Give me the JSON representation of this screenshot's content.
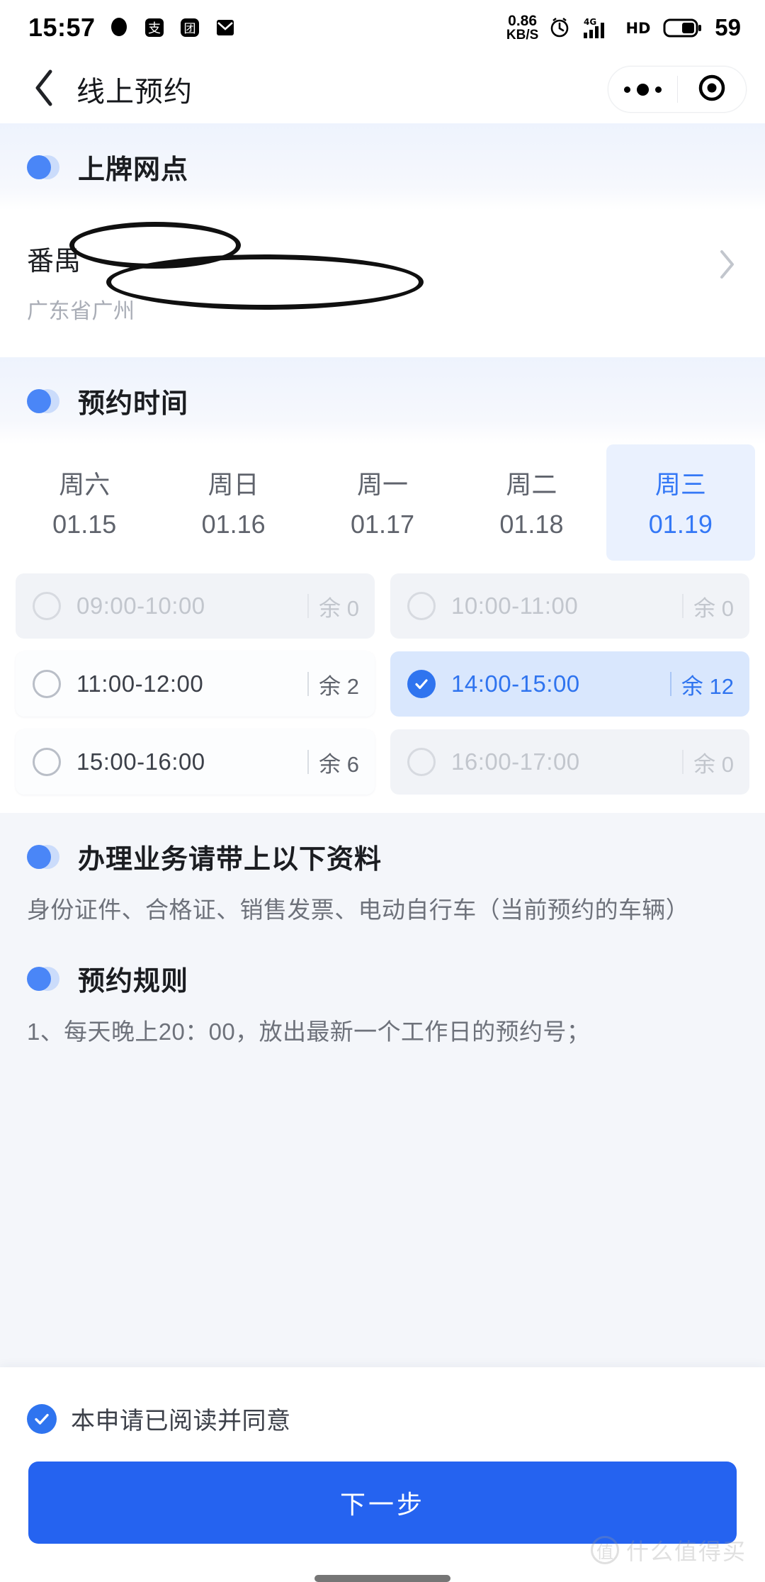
{
  "status_bar": {
    "time": "15:57",
    "net_speed_value": "0.86",
    "net_speed_unit": "KB/S",
    "network_type": "4G",
    "audio_badge": "HD",
    "battery_percent": "59",
    "left_icons": [
      "chat-bubble-icon",
      "alipay-icon",
      "meituan-icon",
      "mail-icon"
    ],
    "right_icons": [
      "alarm-clock-icon",
      "signal-bars-icon",
      "hd-audio-icon",
      "battery-icon"
    ]
  },
  "nav": {
    "back_icon": "chevron-left-icon",
    "title": "线上预约",
    "capsule": {
      "more_icon": "more-dots-icon",
      "close_icon": "target-circle-icon"
    }
  },
  "sections": {
    "store": {
      "heading": "上牌网点",
      "name": "番禺",
      "address": "广东省广州",
      "chevron_icon": "chevron-right-icon"
    },
    "time": {
      "heading": "预约时间"
    },
    "materials": {
      "heading": "办理业务请带上以下资料",
      "text": "身份证件、合格证、销售发票、电动自行车（当前预约的车辆）"
    },
    "rules": {
      "heading": "预约规则",
      "items": [
        "1、每天晚上20：00，放出最新一个工作日的预约号；"
      ]
    }
  },
  "dates": [
    {
      "weekday": "周六",
      "date": "01.15",
      "selected": false
    },
    {
      "weekday": "周日",
      "date": "01.16",
      "selected": false
    },
    {
      "weekday": "周一",
      "date": "01.17",
      "selected": false
    },
    {
      "weekday": "周二",
      "date": "01.18",
      "selected": false
    },
    {
      "weekday": "周三",
      "date": "01.19",
      "selected": true
    }
  ],
  "slots": [
    {
      "time": "09:00-10:00",
      "remaining": "余 0",
      "state": "disabled"
    },
    {
      "time": "10:00-11:00",
      "remaining": "余 0",
      "state": "disabled"
    },
    {
      "time": "11:00-12:00",
      "remaining": "余 2",
      "state": "available"
    },
    {
      "time": "14:00-15:00",
      "remaining": "余 12",
      "state": "selected"
    },
    {
      "time": "15:00-16:00",
      "remaining": "余 6",
      "state": "available"
    },
    {
      "time": "16:00-17:00",
      "remaining": "余 0",
      "state": "disabled"
    }
  ],
  "bottom": {
    "agree_label": "本申请已阅读并同意",
    "agree_checked": true,
    "next_label": "下一步"
  },
  "watermark": {
    "mark": "值",
    "text": "什么值得买"
  },
  "colors": {
    "accent": "#2f74ef",
    "button": "#2563f0",
    "selected_slot_bg": "#d9e7fd",
    "disabled_text": "#c2c6cd",
    "page_bg": "#f4f6fa"
  }
}
